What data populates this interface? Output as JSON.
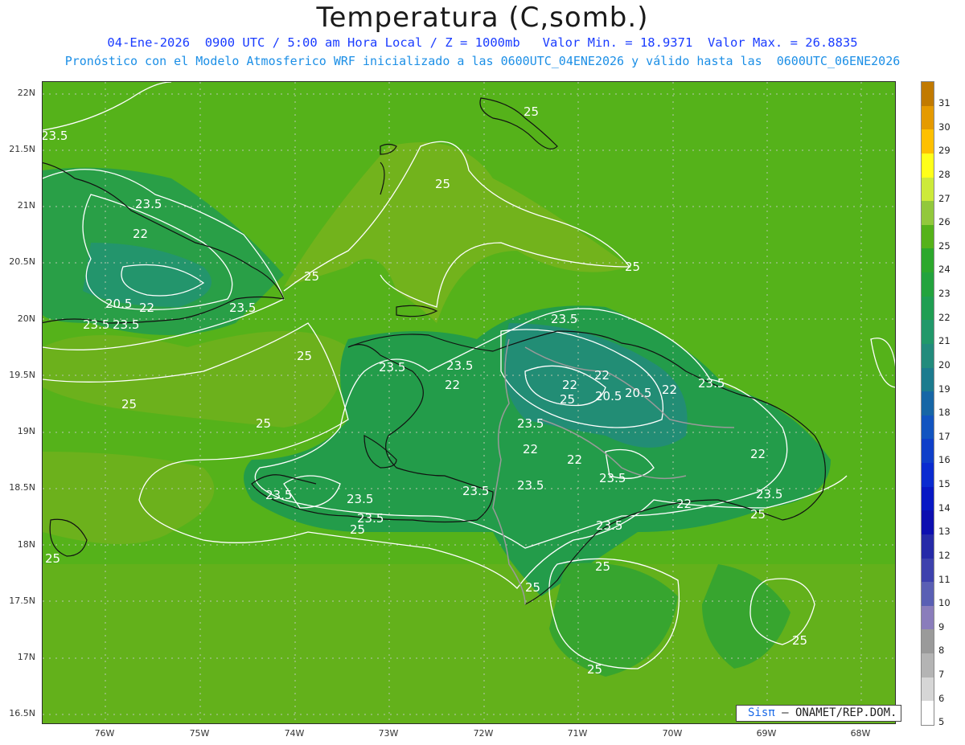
{
  "title": "Temperatura (C,somb.)",
  "subtitle_line1": "04-Ene-2026  0900 UTC / 5:00 am Hora Local / Z = 1000mb   Valor Min. = 18.9371  Valor Max. = 26.8835",
  "subtitle_line2": "Pronóstico con el Modelo Atmosferico WRF inicializado a las 0600UTC_04ENE2026 y válido hasta las  0600UTC_06ENE2026",
  "credit": {
    "sis": "Sisπ",
    "rest": " – ONAMET/REP.DOM."
  },
  "lat_labels": [
    "22N",
    "21.5N",
    "21N",
    "20.5N",
    "20N",
    "19.5N",
    "19N",
    "18.5N",
    "18N",
    "17.5N",
    "17N",
    "16.5N"
  ],
  "lon_labels": [
    "76W",
    "75W",
    "74W",
    "73W",
    "72W",
    "71W",
    "70W",
    "69W",
    "68W"
  ],
  "contour_labels": [
    "23.5",
    "25",
    "22",
    "20.5"
  ],
  "colorbar": {
    "levels": [
      "31",
      "30",
      "29",
      "28",
      "27",
      "26",
      "25",
      "24",
      "23",
      "22",
      "21",
      "20",
      "19",
      "18",
      "17",
      "16",
      "15",
      "14",
      "13",
      "12",
      "11",
      "10",
      "9",
      "8",
      "7",
      "6",
      "5"
    ],
    "colors": [
      "#c17a00",
      "#e59a00",
      "#ffc000",
      "#ffff1a",
      "#cdea3a",
      "#92c83c",
      "#55b21a",
      "#2ca82c",
      "#23a33d",
      "#1f9e52",
      "#21986a",
      "#228b7c",
      "#1c7b8e",
      "#1766a6",
      "#1254c0",
      "#0f3fc9",
      "#0a2bd0",
      "#0818c4",
      "#0d0fb0",
      "#262aa8",
      "#3d41ad",
      "#5a5fb4",
      "#8a7dbb",
      "#9a9a9a",
      "#b4b4b4",
      "#d6d6d6",
      "#ffffff"
    ]
  }
}
